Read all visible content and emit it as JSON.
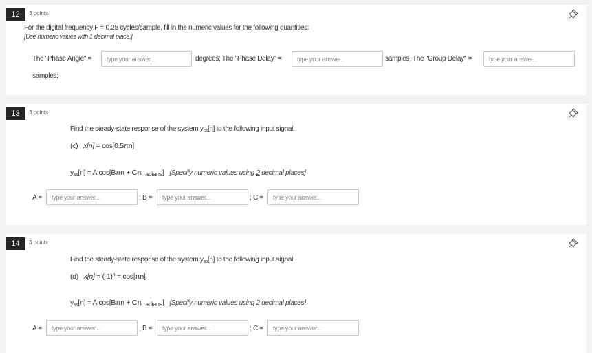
{
  "questions": [
    {
      "number": "12",
      "points": "3 points",
      "prompt": "For the digital frequency F = 0.25 cycles/sample, fill in the numeric values for the following quantities:",
      "note": "[Use numeric values with 1 decimal place.]",
      "labels": {
        "phase_angle": "The \"Phase Angle\" =",
        "degrees_phase_delay": "degrees; The \"Phase Delay\" =",
        "samples_group_delay": "samples; The \"Group Delay\" =",
        "samples_end": "samples;"
      },
      "placeholder": "type your answer..."
    },
    {
      "number": "13",
      "points": "3 points",
      "prompt": "Find the steady-state response of the system y",
      "prompt_sub": "ss",
      "prompt_tail": "[n] to the following input signal:",
      "part_label": "(c)",
      "signal_lhs": "x[n]",
      "signal_rhs": "= cos[0.5πn]",
      "resp_y": "y",
      "resp_sub": "ss",
      "resp_mid": "[n] = A cos[Bπn + Cπ",
      "resp_units": "radians",
      "resp_close": "]",
      "spec_pre": "[Specify numeric values using ",
      "spec_num": "2",
      "spec_post": " decimal places]",
      "labels": {
        "a": "A =",
        "b": "; B =",
        "c": "; C ="
      },
      "placeholder": "type your answer..."
    },
    {
      "number": "14",
      "points": "3 points",
      "prompt": "Find the steady-state response of the system y",
      "prompt_sub": "ss",
      "prompt_tail": "[n] to the following input signal:",
      "part_label": "(d)",
      "signal_lhs": "x[n]",
      "signal_mid": "= (-1)",
      "signal_sup": "n",
      "signal_rhs": " = cos[πn]",
      "resp_y": "y",
      "resp_sub": "ss",
      "resp_mid": "[n] = A cos[Bπn + Cπ",
      "resp_units": "radians",
      "resp_close": "]",
      "spec_pre": "[Specify numeric values using ",
      "spec_num": "2",
      "spec_post": " decimal places]",
      "labels": {
        "a": "A =",
        "b": "; B =",
        "c": "; C ="
      },
      "placeholder": "type your answer..."
    }
  ],
  "icons": {
    "pin": "pushpin-icon"
  }
}
